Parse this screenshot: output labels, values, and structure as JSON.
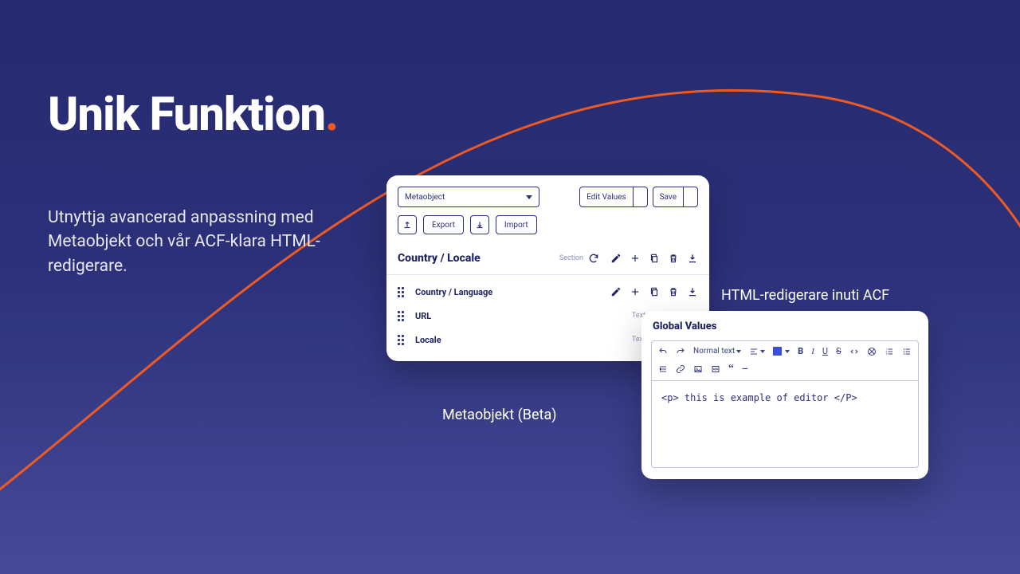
{
  "headline": {
    "text": "Unik Funktion",
    "dot": "."
  },
  "subhead": "Utnyttja avancerad anpassning med Metaobjekt och vår ACF-klara HTML-redigerare.",
  "panel1": {
    "caption": "Metaobjekt (Beta)",
    "objectDropdown": "Metaobject",
    "editValues": "Edit Values",
    "save": "Save",
    "export": "Export",
    "import": "Import",
    "section": {
      "title": "Country / Locale",
      "label": "Section"
    },
    "fields": [
      {
        "name": "Country / Language",
        "type": "",
        "full": true
      },
      {
        "name": "URL",
        "type": "Text",
        "full": false
      },
      {
        "name": "Locale",
        "type": "Text",
        "full": false
      }
    ]
  },
  "panel2": {
    "caption": "HTML-redigerare inuti ACF",
    "title": "Global Values",
    "styleLabel": "Normal text",
    "content": "<p> this is example of editor </P>"
  }
}
